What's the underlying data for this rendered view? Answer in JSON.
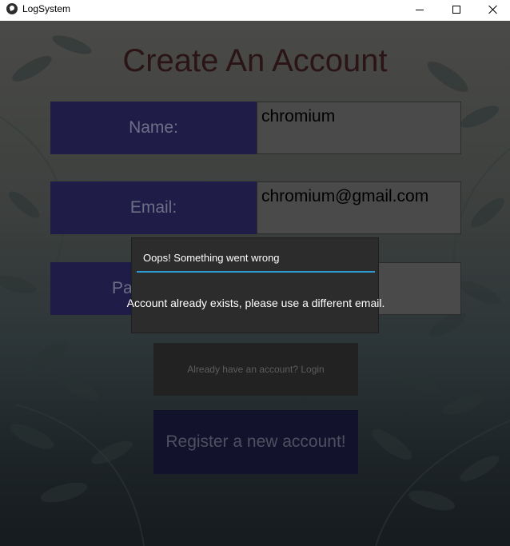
{
  "window": {
    "title": "LogSystem",
    "icon": "kivy-icon",
    "controls": [
      "minimize-icon",
      "maximize-icon",
      "close-icon"
    ]
  },
  "page": {
    "title": "Create An Account"
  },
  "form": {
    "name": {
      "label": "Name:",
      "value": "chromium"
    },
    "email": {
      "label": "Email:",
      "value": "chromium@gmail.com"
    },
    "password": {
      "label": "Pa",
      "value": ""
    }
  },
  "buttons": {
    "login": "Already have an account? Login",
    "register": "Register a new account!"
  },
  "popup": {
    "title": "Oops! Something went wrong",
    "message": "Account already exists, please use a different email.",
    "accent_color": "#2e9ad3"
  },
  "colors": {
    "label_bg": "#1f1d48",
    "input_bg": "#4a4a4a",
    "title_color": "#2a1416"
  }
}
